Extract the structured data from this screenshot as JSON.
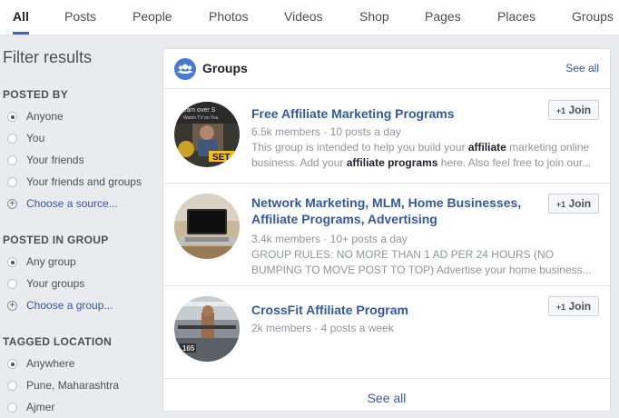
{
  "tabs": [
    "All",
    "Posts",
    "People",
    "Photos",
    "Videos",
    "Shop",
    "Pages",
    "Places",
    "Groups"
  ],
  "sidebar": {
    "title": "Filter results",
    "posted_by": {
      "heading": "POSTED BY",
      "options": [
        "Anyone",
        "You",
        "Your friends",
        "Your friends and groups"
      ],
      "choose": "Choose a source..."
    },
    "posted_in_group": {
      "heading": "POSTED IN GROUP",
      "options": [
        "Any group",
        "Your groups"
      ],
      "choose": "Choose a group..."
    },
    "tagged_location": {
      "heading": "TAGGED LOCATION",
      "options": [
        "Anywhere",
        "Pune, Maharashtra",
        "Ajmer"
      ]
    }
  },
  "panel": {
    "title": "Groups",
    "see_all_top": "See all",
    "see_all_bottom": "See all",
    "join_label": "Join",
    "join_icon_text": "+1",
    "groups": [
      {
        "title": "Free Affiliate Marketing Programs",
        "meta": "6.5k members · 10 posts a day",
        "desc1_a": "This group is intended to help you build your ",
        "desc1_b": "affiliate",
        "desc1_c": " marketing online",
        "desc2_a": "business. Add your ",
        "desc2_b": "affiliate programs",
        "desc2_c": " here. Also feel free to join our...",
        "thumb_text_top": "Team over S",
        "thumb_text_mid": "Watch TV on You",
        "thumb_text_badge": "SET"
      },
      {
        "title_line1": "Network Marketing, MLM, Home Businesses,",
        "title_line2": "Affiliate Programs, Advertising",
        "meta": "3.4k members · 10+ posts a day",
        "desc1": "GROUP RULES: NO MORE THAN 1 AD PER 24 HOURS (NO",
        "desc2": "BUMPING TO MOVE POST TO TOP) Advertise your home business..."
      },
      {
        "title": "CrossFit Affiliate Program",
        "meta": "2k members · 4 posts a week",
        "thumb_text": "165"
      }
    ]
  }
}
